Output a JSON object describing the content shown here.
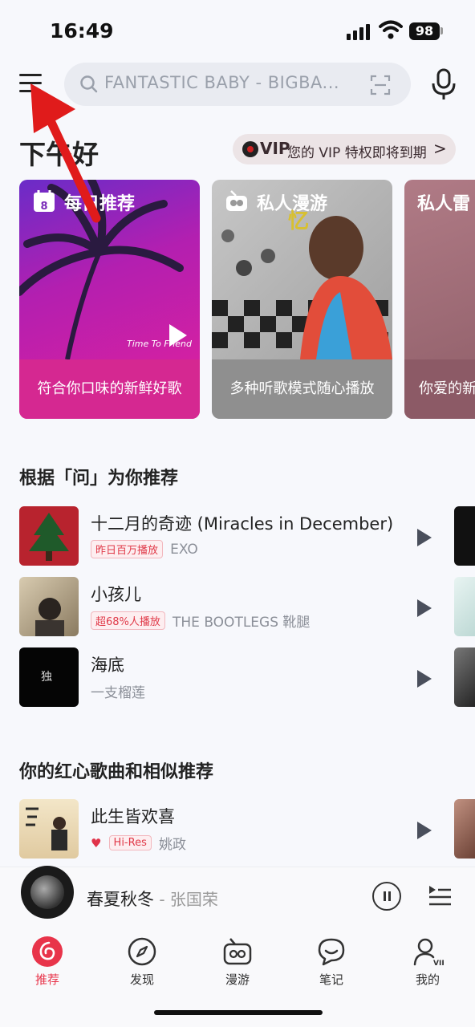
{
  "status_bar": {
    "time": "16:49",
    "battery": "98"
  },
  "header": {
    "search_placeholder": "FANTASTIC BABY - BIGBA..."
  },
  "greeting": "下午好",
  "vip_banner": {
    "badge": "VIP",
    "text": "您的 VIP 特权即将到期",
    "chevron": ">"
  },
  "cards": [
    {
      "title": "每日推荐",
      "subtitle": "符合你口味的新鲜好歌",
      "calendar_day": "8",
      "caption": "Time To Friend"
    },
    {
      "title": "私人漫游",
      "subtitle": "多种听歌模式随心播放"
    },
    {
      "title": "私人雷",
      "subtitle": "你爱的新"
    }
  ],
  "sections": {
    "recommend_title": "根据「问」为你推荐",
    "hearts_title": "你的红心歌曲和相似推荐"
  },
  "songs": [
    {
      "title": "十二月的奇迹 (Miracles in December)",
      "badge": "昨日百万播放",
      "artist": "EXO"
    },
    {
      "title": "小孩儿",
      "badge": "超68%人播放",
      "artist": "THE BOOTLEGS 靴腿"
    },
    {
      "title": "海底",
      "badge": "",
      "artist": "一支榴莲",
      "cover_text": "独"
    }
  ],
  "heart_songs": [
    {
      "title": "此生皆欢喜",
      "badge": "Hi-Res",
      "artist": "姚政"
    }
  ],
  "player": {
    "song": "春夏秋冬",
    "artist": " - 张国荣"
  },
  "tabs": [
    {
      "label": "推荐",
      "icon": "netease-logo-icon"
    },
    {
      "label": "发现",
      "icon": "compass-icon"
    },
    {
      "label": "漫游",
      "icon": "radio-icon"
    },
    {
      "label": "笔记",
      "icon": "chat-bubble-icon"
    },
    {
      "label": "我的",
      "icon": "user-vip-icon"
    }
  ],
  "colors": {
    "accent": "#e8344a",
    "background": "#f7f8fc",
    "annotation_arrow": "#e01b1b"
  }
}
